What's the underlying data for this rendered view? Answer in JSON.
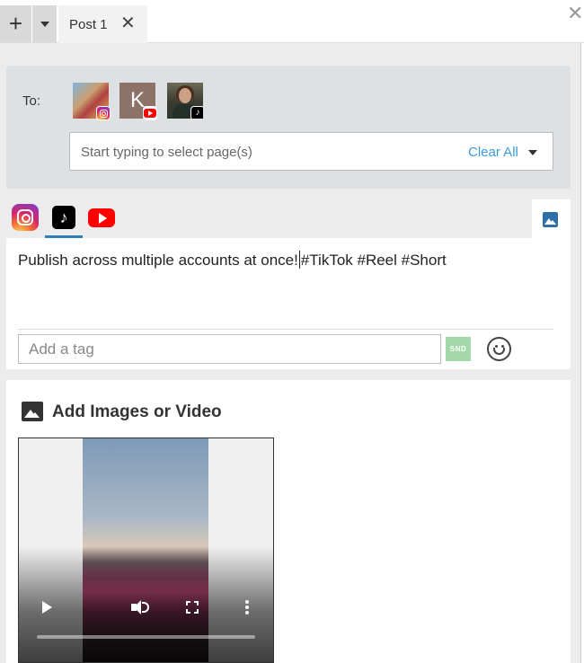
{
  "topbar": {
    "add_label": "+",
    "post_tab": {
      "label": "Post 1",
      "close": "✕"
    },
    "window_close": "✕"
  },
  "recipients": {
    "label": "To:",
    "accounts": [
      {
        "network": "instagram",
        "icon": "instagram-badge-icon"
      },
      {
        "network": "youtube",
        "initial": "K",
        "icon": "youtube-badge-icon"
      },
      {
        "network": "tiktok",
        "icon": "tiktok-badge-icon"
      }
    ],
    "page_select": {
      "placeholder": "Start typing to select page(s)",
      "clear_label": "Clear All"
    }
  },
  "compose": {
    "networks": [
      "instagram",
      "tiktok",
      "youtube"
    ],
    "active_network": "tiktok",
    "text_before_cursor": "Publish across multiple accounts at once!",
    "text_after_cursor": "#TikTok #Reel #Short",
    "tag_placeholder": "Add a tag",
    "snd_label": "SND"
  },
  "media": {
    "title": "Add Images or Video",
    "video": {
      "progress": 0
    }
  },
  "colors": {
    "accent": "#3a9bd9",
    "tab_underline": "#2e7fb8",
    "panel_bg": "#dde1e3",
    "snd_bg": "#a3d9a8"
  }
}
